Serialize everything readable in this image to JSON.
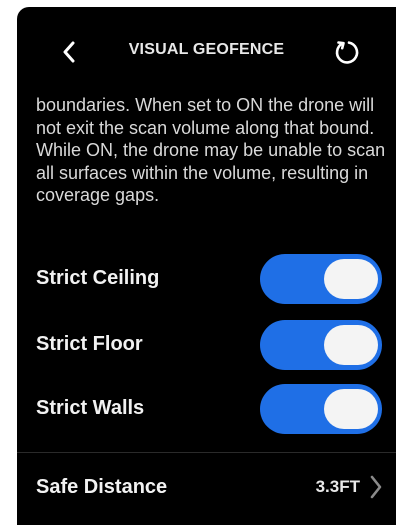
{
  "header": {
    "title": "VISUAL GEOFENCE",
    "back_icon": "chevron-left-icon",
    "reset_icon": "reset-icon"
  },
  "description": "boundaries. When set to ON the drone will not exit the scan volume along that bound. While ON, the drone may be unable to scan all surfaces within the volume, resulting in coverage gaps.",
  "toggles": [
    {
      "label": "Strict Ceiling",
      "state": "on"
    },
    {
      "label": "Strict Floor",
      "state": "on"
    },
    {
      "label": "Strict Walls",
      "state": "on"
    }
  ],
  "safe_distance": {
    "label": "Safe Distance",
    "value": "3.3FT",
    "icon": "chevron-right-icon"
  },
  "colors": {
    "background": "#000000",
    "toggle_on": "#1f6fe6",
    "knob": "#f4f4f4",
    "text": "#f2f2f2"
  }
}
